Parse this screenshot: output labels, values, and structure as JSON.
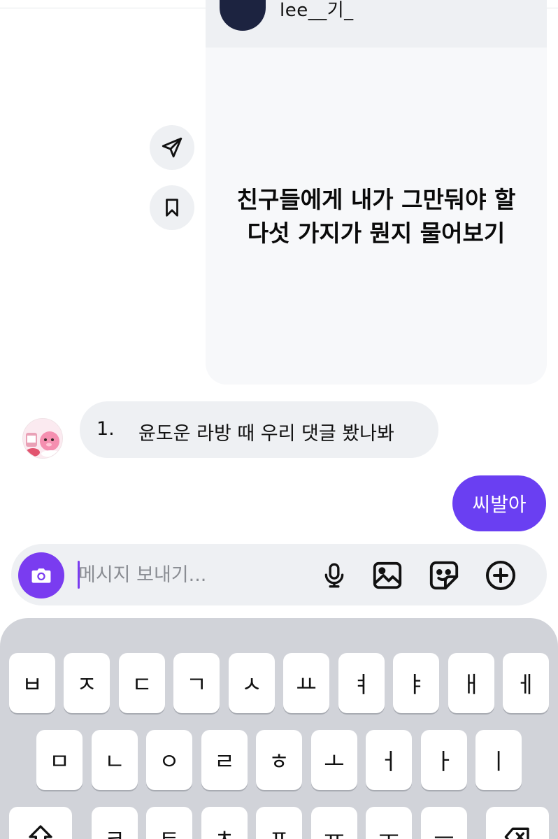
{
  "shared_post": {
    "username": "lee__기_",
    "body_line1": "친구들에게 내가 그만둬야 할",
    "body_line2": "다섯 가지가 뭔지 물어보기"
  },
  "incoming_message": {
    "number": "1.",
    "text": "윤도운 라방 때 우리 댓글 봤나봐"
  },
  "outgoing_message": {
    "text": "씨발아"
  },
  "composer": {
    "placeholder": "메시지 보내기..."
  },
  "keyboard": {
    "row1": [
      "ㅂ",
      "ㅈ",
      "ㄷ",
      "ㄱ",
      "ㅅ",
      "ㅛ",
      "ㅕ",
      "ㅑ",
      "ㅐ",
      "ㅔ"
    ],
    "row2": [
      "ㅁ",
      "ㄴ",
      "ㅇ",
      "ㄹ",
      "ㅎ",
      "ㅗ",
      "ㅓ",
      "ㅏ",
      "ㅣ"
    ],
    "row3": [
      "ㅋ",
      "ㅌ",
      "ㅊ",
      "ㅍ",
      "ㅠ",
      "ㅜ",
      "ㅡ"
    ]
  },
  "icons": {
    "share": "send-icon",
    "save": "bookmark-icon",
    "camera": "camera-icon",
    "mic": "microphone-icon",
    "gallery": "image-icon",
    "sticker": "sticker-icon",
    "plus": "plus-circle-icon",
    "shift": "shift-icon",
    "backspace": "backspace-icon"
  },
  "colors": {
    "accent": "#6a3ff2",
    "bubble_in": "#eef0f3",
    "keyboard_bg": "#d1d3d9"
  }
}
